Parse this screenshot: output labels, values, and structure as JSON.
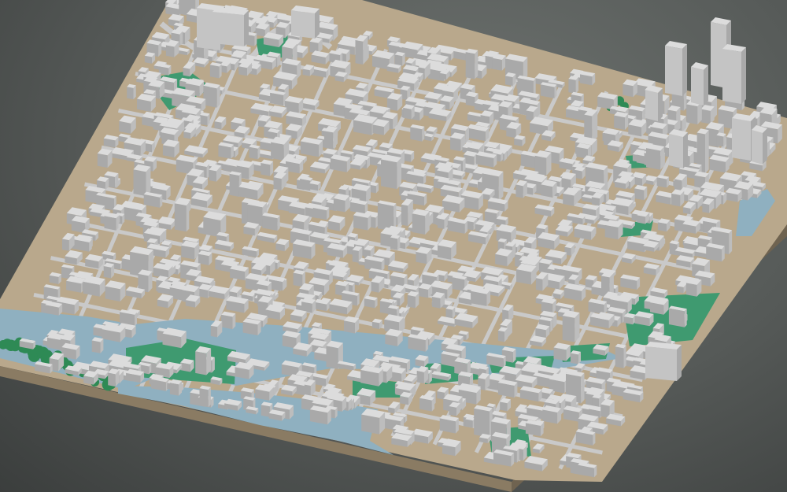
{
  "scene": {
    "kind": "3d-city-model",
    "view": "oblique-aerial",
    "visible_text": []
  },
  "colors": {
    "background": "#565a58",
    "ground": "#b9a88c",
    "water": "#8fb0c0",
    "park": "#3f9a70",
    "trees": "#2e8a55",
    "road": "#c9c9c9",
    "building_top": "#dcdcdc",
    "building_side": "#a9a9a9",
    "base_edge": "#8a7b63"
  },
  "features": {
    "rivers": 2,
    "parks": 8,
    "high_rise_cluster": "upper-right"
  }
}
